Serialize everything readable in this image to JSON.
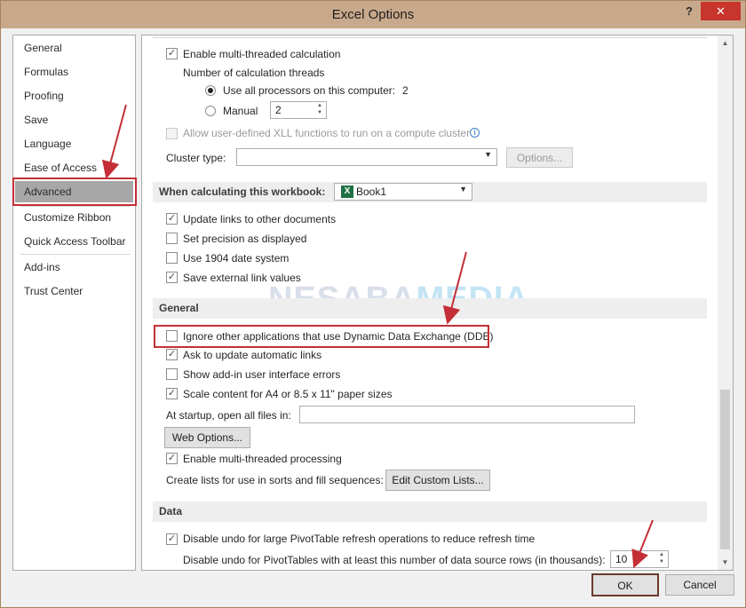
{
  "window": {
    "title": "Excel Options",
    "help_label": "?",
    "close_label": "✕"
  },
  "nav": {
    "items": [
      {
        "label": "General"
      },
      {
        "label": "Formulas"
      },
      {
        "label": "Proofing"
      },
      {
        "label": "Save"
      },
      {
        "label": "Language"
      },
      {
        "label": "Ease of Access"
      },
      {
        "label": "Advanced",
        "selected": true
      },
      {
        "label": "Customize Ribbon"
      },
      {
        "label": "Quick Access Toolbar"
      },
      {
        "label": "Add-ins"
      },
      {
        "label": "Trust Center"
      }
    ]
  },
  "formulas": {
    "multithreaded_label": "Enable multi-threaded calculation",
    "threads_label": "Number of calculation threads",
    "use_all_label": "Use all processors on this computer:",
    "use_all_count": "2",
    "manual_label": "Manual",
    "manual_value": "2",
    "xll_label": "Allow user-defined XLL functions to run on a compute cluster",
    "cluster_type_label": "Cluster type:",
    "options_button": "Options..."
  },
  "workbook": {
    "header": "When calculating this workbook:",
    "selected_workbook": "Book1",
    "items": [
      {
        "label": "Update links to other documents",
        "checked": true
      },
      {
        "label": "Set precision as displayed",
        "checked": false
      },
      {
        "label": "Use 1904 date system",
        "checked": false
      },
      {
        "label": "Save external link values",
        "checked": true
      }
    ]
  },
  "general": {
    "header": "General",
    "items": [
      {
        "label": "Ignore other applications that use Dynamic Data Exchange (DDE)",
        "checked": false
      },
      {
        "label": "Ask to update automatic links",
        "checked": true
      },
      {
        "label": "Show add-in user interface errors",
        "checked": false
      },
      {
        "label": "Scale content for A4 or 8.5 x 11\" paper sizes",
        "checked": true
      }
    ],
    "startup_label": "At startup, open all files in:",
    "startup_value": "",
    "web_options_button": "Web Options...",
    "multithreaded_processing_label": "Enable multi-threaded processing",
    "custom_lists_label": "Create lists for use in sorts and fill sequences:",
    "custom_lists_button": "Edit Custom Lists..."
  },
  "data": {
    "header": "Data",
    "disable_undo_label": "Disable undo for large PivotTable refresh operations to reduce refresh time",
    "undo_rows_label": "Disable undo for PivotTables with at least this number of data source rows (in thousands):",
    "undo_rows_value": "10"
  },
  "footer": {
    "ok_label": "OK",
    "cancel_label": "Cancel"
  },
  "watermark": {
    "part1": "NESABA",
    "part2": "MEDIA"
  },
  "colors": {
    "annotation_red": "#c42f37",
    "titlebar": "#c9a98c",
    "close": "#c7352c"
  },
  "icons": {
    "check": "check-icon",
    "info": "info-icon",
    "excel": "excel-workbook-icon"
  }
}
